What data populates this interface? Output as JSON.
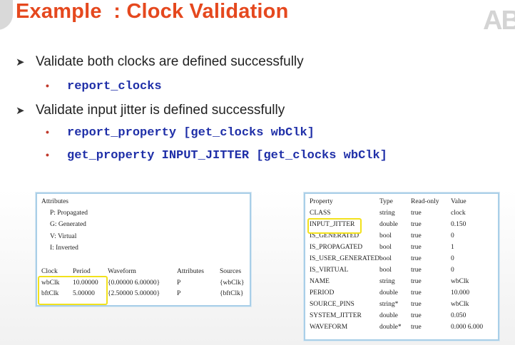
{
  "slide": {
    "title": "Example  : Clock Validation",
    "logo": "AB",
    "bullets": [
      {
        "text": "Validate both clocks are defined successfully",
        "subs": [
          "report_clocks"
        ]
      },
      {
        "text": "Validate input jitter is defined successfully",
        "subs": [
          "report_property [get_clocks wbClk]",
          "get_property INPUT_JITTER [get_clocks wbClk]"
        ]
      }
    ]
  },
  "clock_report": {
    "attributes_header": "Attributes",
    "legend": [
      "P: Propagated",
      "G: Generated",
      "V: Virtual",
      "I: Inverted"
    ],
    "columns": [
      "Clock",
      "Period",
      "Waveform",
      "Attributes",
      "Sources"
    ],
    "rows": [
      [
        "wbClk",
        "10.00000",
        "{0.00000 6.00000}",
        "P",
        "{wbClk}"
      ],
      [
        "bftClk",
        "5.00000",
        "{2.50000 5.00000}",
        "P",
        "{bftClk}"
      ]
    ]
  },
  "property_report": {
    "columns": [
      "Property",
      "Type",
      "Read-only",
      "Value"
    ],
    "rows": [
      [
        "CLASS",
        "string",
        "true",
        "clock"
      ],
      [
        "INPUT_JITTER",
        "double",
        "true",
        "0.150"
      ],
      [
        "IS_GENERATED",
        "bool",
        "true",
        "0"
      ],
      [
        "IS_PROPAGATED",
        "bool",
        "true",
        "1"
      ],
      [
        "IS_USER_GENERATED",
        "bool",
        "true",
        "0"
      ],
      [
        "IS_VIRTUAL",
        "bool",
        "true",
        "0"
      ],
      [
        "NAME",
        "string",
        "true",
        "wbClk"
      ],
      [
        "PERIOD",
        "double",
        "true",
        "10.000"
      ],
      [
        "SOURCE_PINS",
        "string*",
        "true",
        "wbClk"
      ],
      [
        "SYSTEM_JITTER",
        "double",
        "true",
        "0.050"
      ],
      [
        "WAVEFORM",
        "double*",
        "true",
        "0.000 6.000"
      ]
    ]
  },
  "colors": {
    "title": "#e5481e",
    "code": "#1f2fa8",
    "bullet_dot": "#c0392b",
    "highlight": "#f2e11c",
    "panel_border": "#a9cfe8"
  }
}
